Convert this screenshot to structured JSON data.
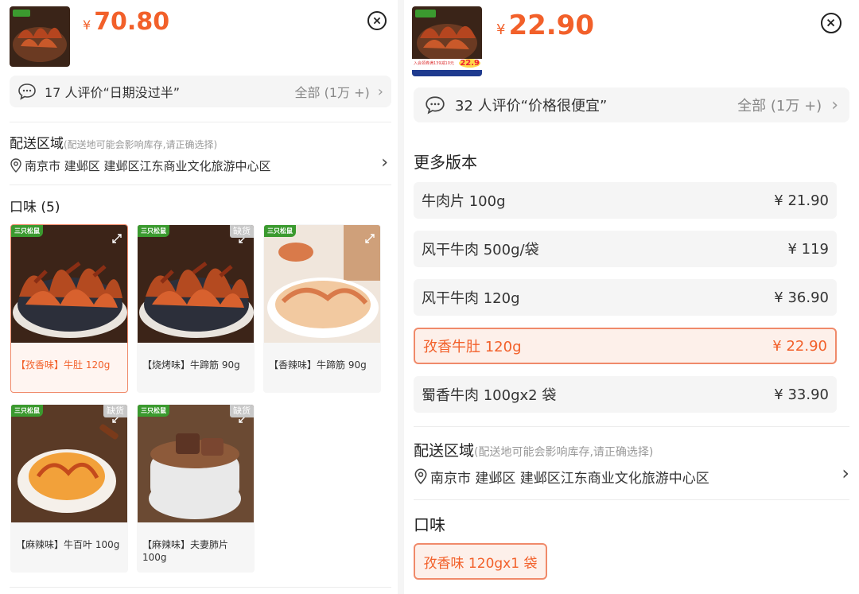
{
  "colors": {
    "accent": "#f2602a",
    "selected_border": "#f08a6a",
    "bg_gray": "#f5f5f5"
  },
  "left": {
    "price": {
      "symbol": "¥",
      "value": "70.80"
    },
    "review": {
      "text": "17 人评价“日期没过半”",
      "all": "全部 (1万 +)",
      "icon": "chat-bubble-icon"
    },
    "delivery": {
      "title": "配送区域",
      "hint": "(配送地可能会影响库存,请正确选择)",
      "address": "南京市  建邺区  建邺区江东商业文化旅游中心区"
    },
    "flavor_title": "口味 (5)",
    "flavors": [
      {
        "label": "【孜香味】牛肚 120g",
        "selected": true,
        "out_of_stock": false,
        "variant": "tripe"
      },
      {
        "label": "【烧烤味】牛蹄筋 90g",
        "selected": false,
        "out_of_stock": true,
        "variant": "tripe"
      },
      {
        "label": "【香辣味】牛蹄筋 90g",
        "selected": false,
        "out_of_stock": false,
        "variant": "tendon"
      },
      {
        "label": "【麻辣味】牛百叶 100g",
        "selected": false,
        "out_of_stock": true,
        "variant": "omasum"
      },
      {
        "label": "【麻辣味】夫妻肺片 100g",
        "selected": false,
        "out_of_stock": true,
        "variant": "sliced"
      }
    ],
    "out_of_stock_label": "缺货",
    "brand_logo": "三只松鼠"
  },
  "right": {
    "price": {
      "symbol": "¥",
      "value": "22.90"
    },
    "review": {
      "text": "32 人评价“价格很便宜”",
      "all": "全部 (1万 +)",
      "icon": "chat-bubble-icon"
    },
    "versions_title": "更多版本",
    "versions": [
      {
        "name": "牛肉片 100g",
        "price": "¥  21.90",
        "selected": false
      },
      {
        "name": "风干牛肉 500g/袋",
        "price": "¥  119",
        "selected": false
      },
      {
        "name": "风干牛肉 120g",
        "price": "¥  36.90",
        "selected": false
      },
      {
        "name": "孜香牛肚 120g",
        "price": "¥  22.90",
        "selected": true
      },
      {
        "name": "蜀香牛肉 100gx2 袋",
        "price": "¥  33.90",
        "selected": false
      }
    ],
    "delivery": {
      "title": "配送区域",
      "hint": "(配送地可能会影响库存,请正确选择)",
      "address": "南京市  建邺区  建邺区江东商业文化旅游中心区"
    },
    "flavor_title": "口味",
    "flavor_chip": "孜香味 120gx1 袋",
    "thumb_badge_price": "22.9",
    "thumb_badge_text": "入会领券满139减10元"
  }
}
